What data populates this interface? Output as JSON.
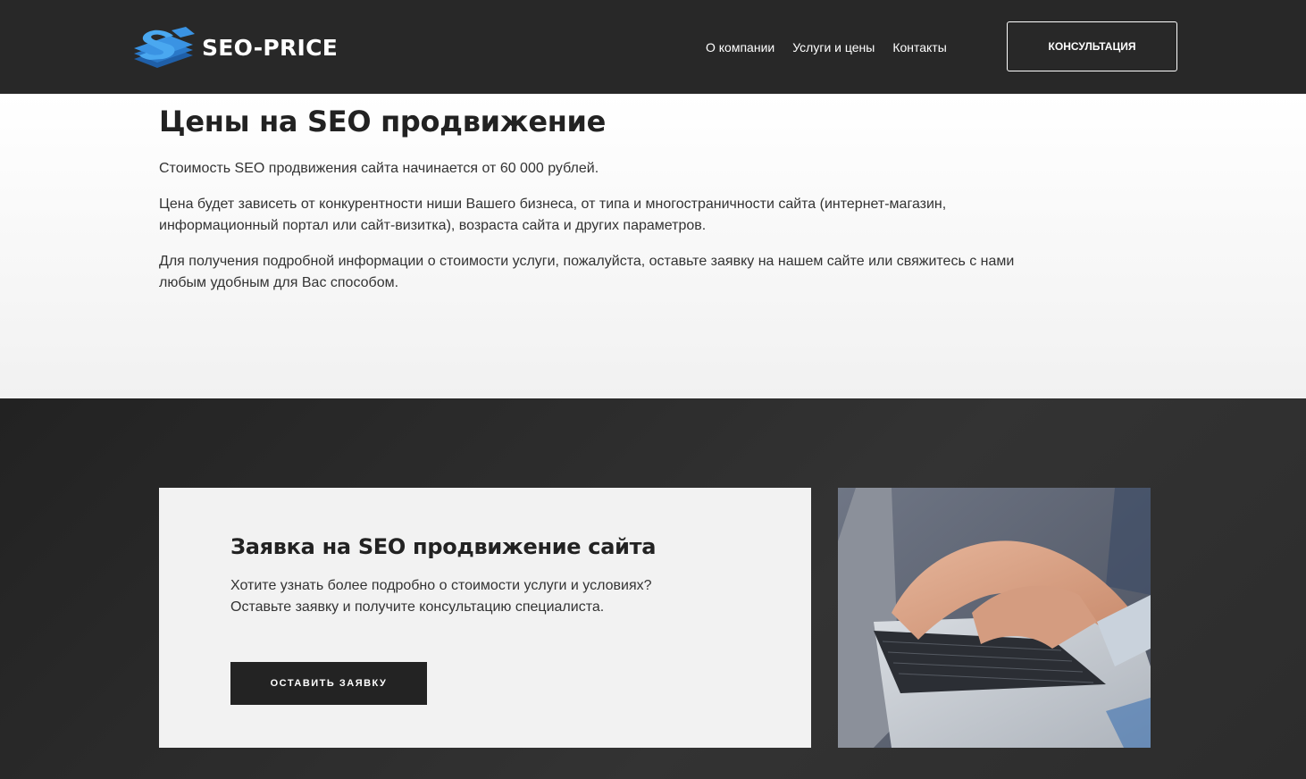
{
  "header": {
    "logo_text": "SEO-PRICE",
    "nav": [
      "О компании",
      "Услуги и цены",
      "Контакты"
    ],
    "cta_label": "КОНСУЛЬТАЦИЯ"
  },
  "prices": {
    "title": "Цены на SEO продвижение",
    "p1": "Стоимость SEO продвижения сайта начинается от 60 000 рублей.",
    "p2_l1": "Цена будет зависеть от конкурентности ниши Вашего бизнеса, от типа и многостраничности сайта (интернет-магазин,",
    "p2_l2": "информационный портал или сайт-визитка), возраста сайта и других параметров.",
    "p3_l1": "Для получения подробной информации о стоимости услуги, пожалуйста, оставьте заявку на нашем сайте или свяжитесь с нами",
    "p3_l2": "любым удобным для Вас способом."
  },
  "request": {
    "title": "Заявка на SEO продвижение сайта",
    "line1": "Хотите узнать более подробно о стоимости услуги и условиях?",
    "line2": "Оставьте заявку и получите консультацию специалиста.",
    "button_label": "ОСТАВИТЬ ЗАЯВКУ"
  },
  "colors": {
    "header_bg": "#282828",
    "accent_blue": "#2f8fe0",
    "card_bg": "#f2f2f2",
    "button_bg": "#232323"
  }
}
